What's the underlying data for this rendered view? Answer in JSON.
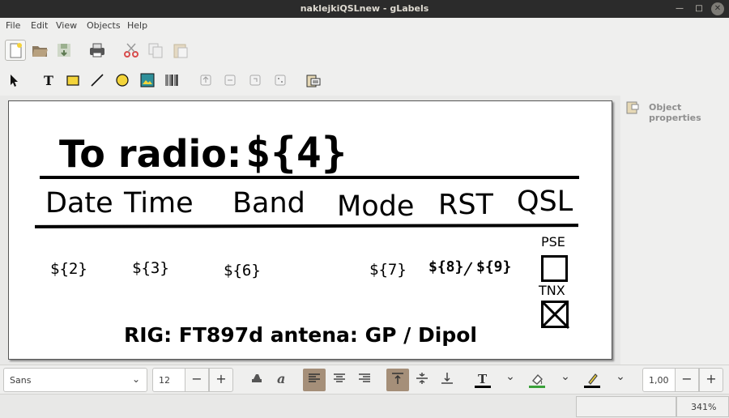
{
  "window": {
    "title": "naklejkiQSLnew - gLabels"
  },
  "menu": [
    "File",
    "Edit",
    "View",
    "Objects",
    "Help"
  ],
  "label": {
    "title": "To radio:",
    "title_field": "${4}",
    "headers": [
      "Date",
      "Time",
      "Band",
      "Mode",
      "RST",
      "QSL"
    ],
    "fields": {
      "date": "${2}",
      "time": "${3}",
      "band": "${6}",
      "mode": "${7}",
      "rst_sent": "${8}",
      "rst_separator": "/",
      "rst_recv": "${9}"
    },
    "pse": "PSE",
    "tnx": "TNX",
    "footer": "RIG: FT897d antena: GP / Dipol"
  },
  "properties_panel": {
    "label": "Object properties"
  },
  "propbar": {
    "font_family": "Sans",
    "font_size": "12",
    "line_width": "1,00",
    "text_color": "#000000",
    "fill_color": "#3aa13a",
    "line_color": "#000000"
  },
  "status": {
    "zoom": "341%"
  },
  "colors": {
    "accent_active": "#a58f79",
    "titlebar": "#2b2b2b"
  }
}
